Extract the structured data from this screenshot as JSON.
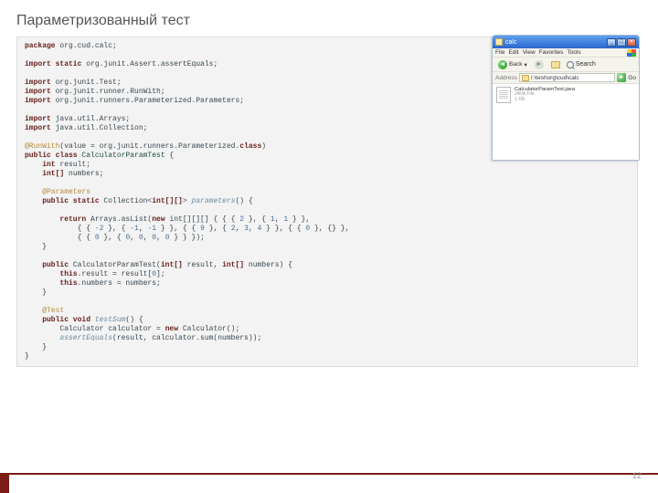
{
  "title": "Параметризованный тест",
  "page_num": "12",
  "code": {
    "package_kw": "package",
    "package": " org.cud.calc;",
    "imp_stat_kw": "import static",
    "imp_stat": " org.junit.Assert.assertEquals;",
    "imp_kw": "import",
    "imp1": " org.junit.Test;",
    "imp2": " org.junit.runner.RunWith;",
    "imp3": " org.junit.runners.Parameterized.Parameters;",
    "imp4": " java.util.Arrays;",
    "imp5": " java.util.Collection;",
    "rw_ann": "@RunWith",
    "rw_open": "(value = org.junit.runners.Parameterized.",
    "rw_cls": "class",
    "rw_close": ")",
    "pub_class": "public class",
    "cls_name": " CalculatorParamTest",
    "brace": " {",
    "int_kw": "int",
    "result_fld": " result;",
    "int_arr": "int[]",
    "numbers_fld": " numbers;",
    "param_ann": "@Parameters",
    "pub_stat": "public static",
    "coll": " Collection<",
    "iarr": "int[][]",
    "coll2": "> ",
    "meth1": "parameters",
    "meth1_rest": "() {",
    "ret": "return",
    "ret_rest": " Arrays.asList(",
    "new_kw": "new",
    "ret_rest2": " int[][][] { { { ",
    "n2": "2",
    "ret_rest3": " }, { ",
    "n1": "1",
    "c_": ", ",
    "ret_rest4": " } },",
    "row2": "            { { ",
    "nm2": "-2",
    "row2b": " }, { ",
    "nm1": "-1",
    "row2c": " } }, { { ",
    "n9": "9",
    "row2d": " }, { ",
    "n2b": "2",
    "n3": "3",
    "n4": "4",
    "row2e": " } }, { { ",
    "n0": "0",
    "row2f": " }, {} },",
    "row3": "            { { ",
    "row3b": " }, { ",
    "row3c": " } } });",
    "cb": "}",
    "pub_kw": "public",
    "ctor": " CalculatorParamTest(",
    "int_kw2": "int[]",
    "p_result": " result, ",
    "int_kw3": "int[]",
    "p_numbers": " numbers) {",
    "this_kw": "this",
    "this1": ".result = result[",
    "z": "0",
    "this1b": "];",
    "this2": ".numbers = numbers;",
    "test_ann": "@Test",
    "pv": "public void",
    "test_m": " testSum",
    "test_rest": "() {",
    "line_calc": "Calculator calculator = ",
    "new2": "new",
    "line_calc2": " Calculator();",
    "assert_call": "assertEquals",
    "assert_rest": "(result, calculator.sum(numbers));"
  },
  "explorer": {
    "title": "calc",
    "menu": {
      "file": "File",
      "edit": "Edit",
      "view": "View",
      "fav": "Favorites",
      "tools": "Tools"
    },
    "back": "Back",
    "search": "Search",
    "addr_lbl": "Address",
    "path": "I:\\test\\org\\cud\\calc",
    "go": "Go",
    "file": {
      "name": "CalculatorParamTest.java",
      "type": "JAVA File",
      "size": "1 KB"
    }
  }
}
